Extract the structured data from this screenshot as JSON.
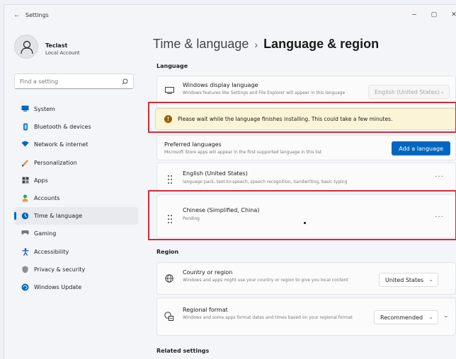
{
  "window": {
    "title": "Settings",
    "back_glyph": "←",
    "minimize_glyph": "–",
    "maximize_glyph": "▢",
    "close_glyph": "✕"
  },
  "profile": {
    "name": "Teclast",
    "account_type": "Local Account"
  },
  "search": {
    "placeholder": "Find a setting",
    "icon": "search-icon"
  },
  "nav": [
    {
      "label": "System",
      "icon": "system-icon",
      "color": "#0067c0",
      "active": false
    },
    {
      "label": "Bluetooth & devices",
      "icon": "bluetooth-icon",
      "color": "#0078d4",
      "active": false
    },
    {
      "label": "Network & internet",
      "icon": "network-icon",
      "color": "#0067c0",
      "active": false
    },
    {
      "label": "Personalization",
      "icon": "personalization-icon",
      "color": "#c87d2b",
      "active": false
    },
    {
      "label": "Apps",
      "icon": "apps-icon",
      "color": "#444444",
      "active": false
    },
    {
      "label": "Accounts",
      "icon": "accounts-icon",
      "color": "#2e9d5a",
      "active": false
    },
    {
      "label": "Time & language",
      "icon": "time-language-icon",
      "color": "#0067c0",
      "active": true
    },
    {
      "label": "Gaming",
      "icon": "gaming-icon",
      "color": "#777777",
      "active": false
    },
    {
      "label": "Accessibility",
      "icon": "accessibility-icon",
      "color": "#1f5fbf",
      "active": false
    },
    {
      "label": "Privacy & security",
      "icon": "privacy-icon",
      "color": "#777777",
      "active": false
    },
    {
      "label": "Windows Update",
      "icon": "windows-update-icon",
      "color": "#0067c0",
      "active": false
    }
  ],
  "breadcrumb": {
    "parent": "Time & language",
    "separator": "›",
    "current": "Language & region"
  },
  "language_section": {
    "heading": "Language",
    "display_language": {
      "title": "Windows display language",
      "subtitle": "Windows features like Settings and File Explorer will appear in this language",
      "value": "English (United States)"
    },
    "warning": {
      "icon_glyph": "!",
      "text": "Please wait while the language finishes installing. This could take a few minutes."
    },
    "preferred": {
      "title": "Preferred languages",
      "subtitle": "Microsoft Store apps will appear in the first supported language in this list",
      "add_button": "Add a language"
    },
    "languages": [
      {
        "name": "English (United States)",
        "detail": "language pack, text-to-speech, speech recognition, handwriting, basic typing",
        "more": "···"
      },
      {
        "name": "Chinese (Simplified, China)",
        "detail": "Pending",
        "more": "···"
      }
    ]
  },
  "region_section": {
    "heading": "Region",
    "country": {
      "title": "Country or region",
      "subtitle": "Windows and apps might use your country or region to give you local content",
      "value": "United States"
    },
    "format": {
      "title": "Regional format",
      "subtitle": "Windows and some apps format dates and times based on your regional format",
      "value": "Recommended"
    }
  },
  "related": {
    "heading": "Related settings"
  },
  "chevron_glyph": "⌄",
  "accent_color": "#0067c0",
  "highlight_color": "#d62a37",
  "warning_color": "#9d5d00"
}
